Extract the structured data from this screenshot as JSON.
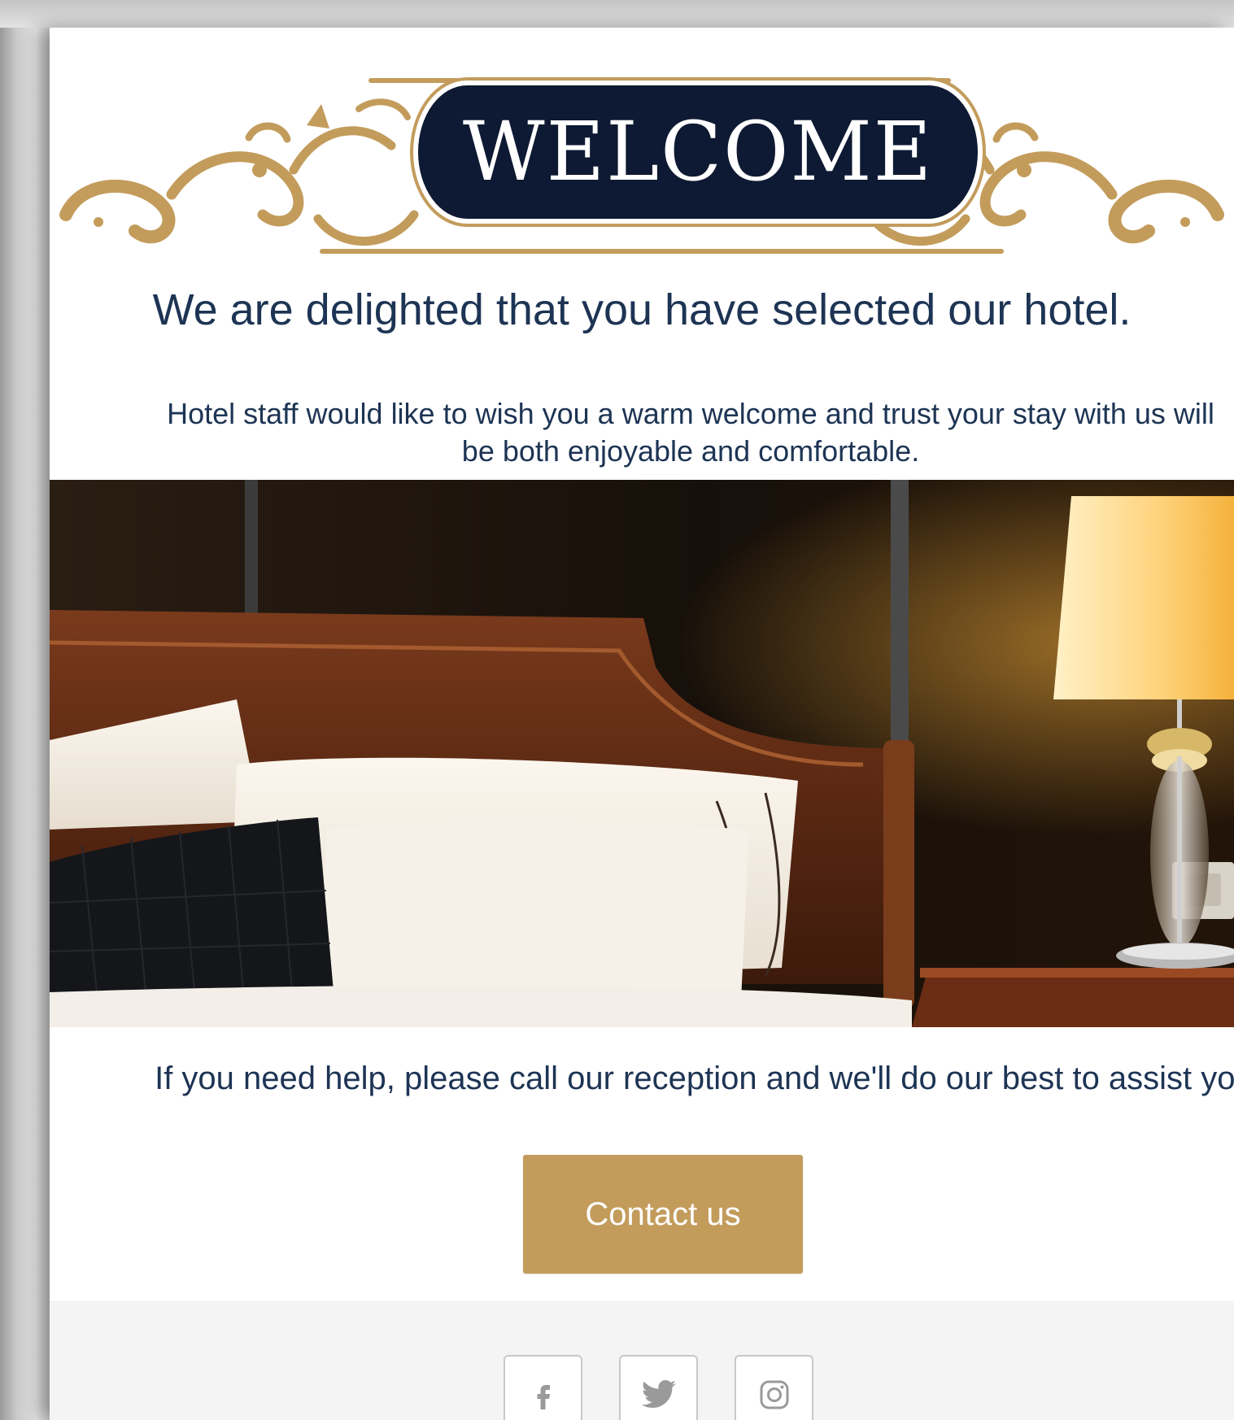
{
  "welcome": {
    "title": "WELCOME"
  },
  "headline": "We are delighted that you have selected our hotel.",
  "intro": {
    "line1": "Hotel staff would like to wish you a warm welcome and trust your stay with us will",
    "line2": "be both enjoyable and comfortable."
  },
  "hero_image": {
    "description_icon": "hotel-bedroom-photo"
  },
  "help": {
    "text": "If you need help, please call our reception and we'll do our best to assist you."
  },
  "contact_button": {
    "label": "Contact us"
  },
  "footer": {
    "social": [
      {
        "name": "facebook",
        "icon": "facebook-icon"
      },
      {
        "name": "twitter",
        "icon": "twitter-icon"
      },
      {
        "name": "instagram",
        "icon": "instagram-icon"
      }
    ]
  },
  "colors": {
    "gold": "#c39c5c",
    "navy": "#0e1a33",
    "text": "#1d3454",
    "footer_bg": "#f4f4f4"
  }
}
